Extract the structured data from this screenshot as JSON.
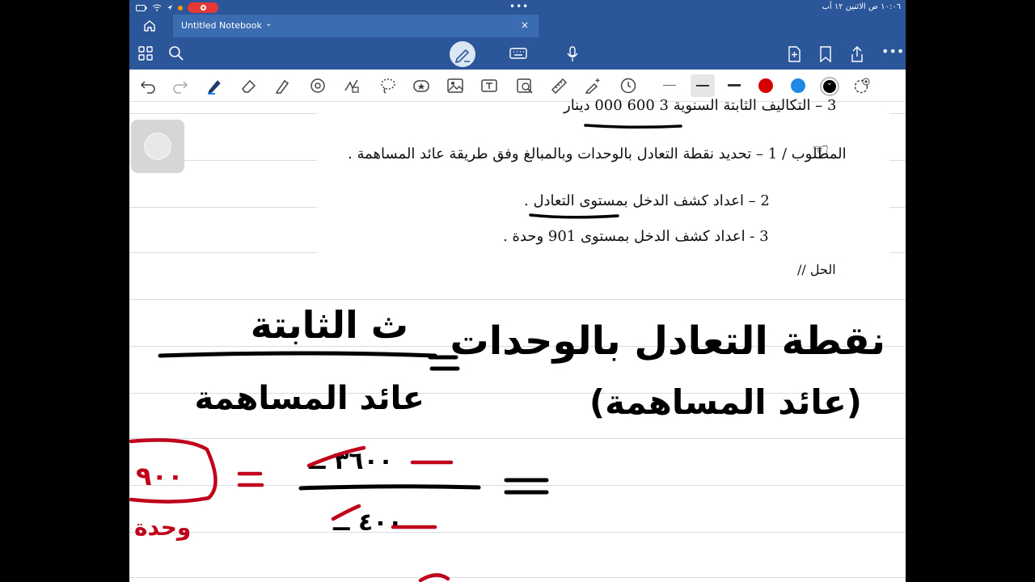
{
  "status_bar": {
    "clock": "١٠:٠٦ ص   الاثنين ١٢ آب"
  },
  "tab": {
    "title": "Untitled Notebook",
    "close": "×"
  },
  "document": {
    "line_fixed_costs": "3 – التكاليف الثابتة السنوية   3 600 000  دينار",
    "line_required": "المطلوب / 1 – تحديد نقطة التعادل بالوحدات وبالمبالغ وفق طريقة عائد المساهمة .",
    "line_task_2": "2 – اعداد كشف الدخل بمستوى التعادل .",
    "line_task_3": "3 - اعداد كشف الدخل بمستوى 901 وحدة .",
    "line_solution": "الحل //"
  },
  "handwriting": {
    "left_numerator": "ث الثابتة",
    "left_denominator": "عائد المساهمة",
    "right_heading": "نقطة التعادل بالوحدات",
    "right_subheading": "(عائد المساهمة)",
    "equals": "=",
    "answer_circled": "٩٠٠",
    "answer_unit": "وحدة",
    "fraction_numerator": "٣٦٠٠ ــ",
    "fraction_denominator": "٤٠٠ ــ"
  },
  "colors": {
    "app_bar": "#2b579a",
    "ink_black": "#000000",
    "ink_red": "#c0001a",
    "palette_red": "#d50000",
    "palette_blue": "#1e88e5"
  }
}
